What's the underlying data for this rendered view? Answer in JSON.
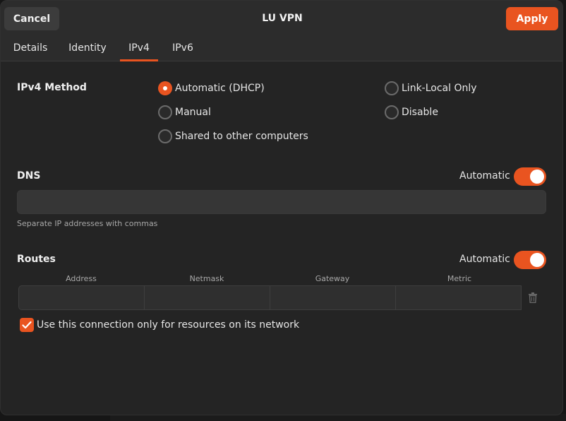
{
  "window": {
    "title": "LU VPN"
  },
  "header": {
    "cancel_label": "Cancel",
    "apply_label": "Apply"
  },
  "tabs": [
    {
      "label": "Details",
      "active": false
    },
    {
      "label": "Identity",
      "active": false
    },
    {
      "label": "IPv4",
      "active": true
    },
    {
      "label": "IPv6",
      "active": false
    }
  ],
  "ipv4_method": {
    "label": "IPv4 Method",
    "options": [
      {
        "label": "Automatic (DHCP)",
        "checked": true
      },
      {
        "label": "Manual",
        "checked": false
      },
      {
        "label": "Shared to other computers",
        "checked": false
      },
      {
        "label": "Link-Local Only",
        "checked": false
      },
      {
        "label": "Disable",
        "checked": false
      }
    ]
  },
  "dns": {
    "label": "DNS",
    "automatic_label": "Automatic",
    "automatic_on": true,
    "value": "",
    "hint": "Separate IP addresses with commas"
  },
  "routes": {
    "label": "Routes",
    "automatic_label": "Automatic",
    "automatic_on": true,
    "columns": [
      "Address",
      "Netmask",
      "Gateway",
      "Metric"
    ],
    "row": {
      "address": "",
      "netmask": "",
      "gateway": "",
      "metric": ""
    }
  },
  "only_local": {
    "label": "Use this connection only for resources on its network",
    "checked": true
  },
  "colors": {
    "accent": "#e95420",
    "background": "#242424",
    "header": "#2c2c2c"
  },
  "icons": {
    "delete": "trash-icon",
    "check": "checkmark-icon"
  }
}
